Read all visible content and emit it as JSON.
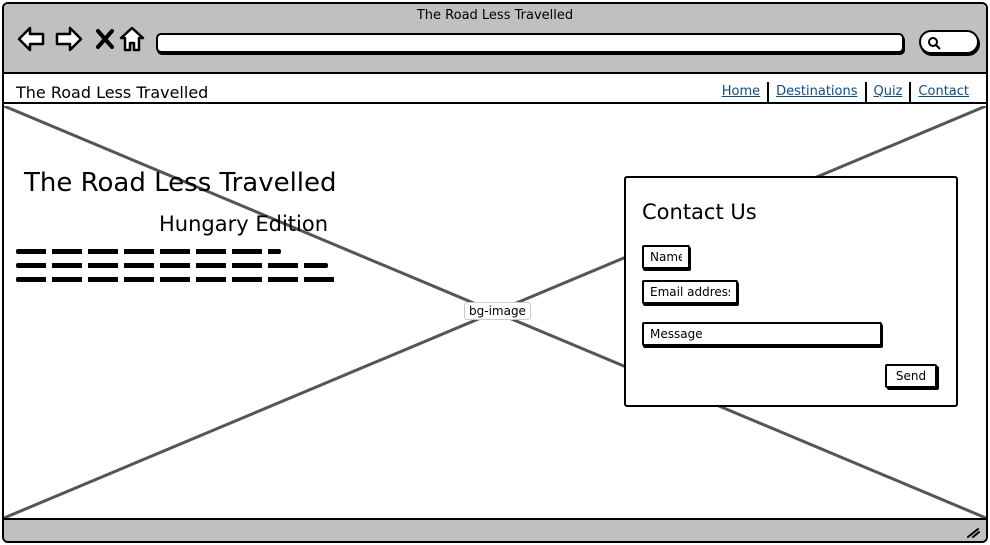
{
  "window": {
    "title": "The Road Less Travelled"
  },
  "browser": {
    "back_icon": "back-arrow-icon",
    "forward_icon": "forward-arrow-icon",
    "stop_icon": "close-icon",
    "home_icon": "home-icon",
    "url_value": "",
    "search_icon": "search-icon"
  },
  "site": {
    "name": "The Road Less Travelled",
    "nav": [
      "Home",
      "Destinations",
      "Quiz",
      "Contact"
    ],
    "link_color": "#0b4f8a"
  },
  "hero": {
    "image_label": "bg-image",
    "title": "The Road Less Travelled",
    "subtitle": "Hungary Edition"
  },
  "contact": {
    "title": "Contact Us",
    "name_placeholder": "Name",
    "email_placeholder": "Email address",
    "message_placeholder": "Message",
    "send_label": "Send"
  },
  "colors": {
    "chrome": "#c0c0c0",
    "border": "#000000"
  }
}
